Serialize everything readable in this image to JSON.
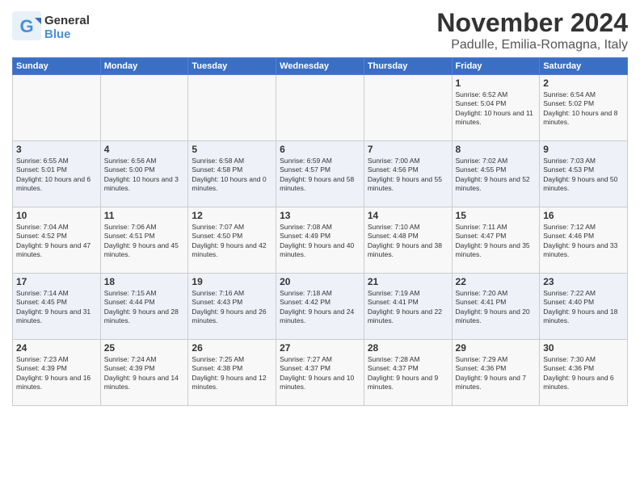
{
  "logo": {
    "line1": "General",
    "line2": "Blue"
  },
  "title": "November 2024",
  "location": "Padulle, Emilia-Romagna, Italy",
  "days_of_week": [
    "Sunday",
    "Monday",
    "Tuesday",
    "Wednesday",
    "Thursday",
    "Friday",
    "Saturday"
  ],
  "weeks": [
    [
      {
        "day": "",
        "info": ""
      },
      {
        "day": "",
        "info": ""
      },
      {
        "day": "",
        "info": ""
      },
      {
        "day": "",
        "info": ""
      },
      {
        "day": "",
        "info": ""
      },
      {
        "day": "1",
        "info": "Sunrise: 6:52 AM\nSunset: 5:04 PM\nDaylight: 10 hours and 11 minutes."
      },
      {
        "day": "2",
        "info": "Sunrise: 6:54 AM\nSunset: 5:02 PM\nDaylight: 10 hours and 8 minutes."
      }
    ],
    [
      {
        "day": "3",
        "info": "Sunrise: 6:55 AM\nSunset: 5:01 PM\nDaylight: 10 hours and 6 minutes."
      },
      {
        "day": "4",
        "info": "Sunrise: 6:56 AM\nSunset: 5:00 PM\nDaylight: 10 hours and 3 minutes."
      },
      {
        "day": "5",
        "info": "Sunrise: 6:58 AM\nSunset: 4:58 PM\nDaylight: 10 hours and 0 minutes."
      },
      {
        "day": "6",
        "info": "Sunrise: 6:59 AM\nSunset: 4:57 PM\nDaylight: 9 hours and 58 minutes."
      },
      {
        "day": "7",
        "info": "Sunrise: 7:00 AM\nSunset: 4:56 PM\nDaylight: 9 hours and 55 minutes."
      },
      {
        "day": "8",
        "info": "Sunrise: 7:02 AM\nSunset: 4:55 PM\nDaylight: 9 hours and 52 minutes."
      },
      {
        "day": "9",
        "info": "Sunrise: 7:03 AM\nSunset: 4:53 PM\nDaylight: 9 hours and 50 minutes."
      }
    ],
    [
      {
        "day": "10",
        "info": "Sunrise: 7:04 AM\nSunset: 4:52 PM\nDaylight: 9 hours and 47 minutes."
      },
      {
        "day": "11",
        "info": "Sunrise: 7:06 AM\nSunset: 4:51 PM\nDaylight: 9 hours and 45 minutes."
      },
      {
        "day": "12",
        "info": "Sunrise: 7:07 AM\nSunset: 4:50 PM\nDaylight: 9 hours and 42 minutes."
      },
      {
        "day": "13",
        "info": "Sunrise: 7:08 AM\nSunset: 4:49 PM\nDaylight: 9 hours and 40 minutes."
      },
      {
        "day": "14",
        "info": "Sunrise: 7:10 AM\nSunset: 4:48 PM\nDaylight: 9 hours and 38 minutes."
      },
      {
        "day": "15",
        "info": "Sunrise: 7:11 AM\nSunset: 4:47 PM\nDaylight: 9 hours and 35 minutes."
      },
      {
        "day": "16",
        "info": "Sunrise: 7:12 AM\nSunset: 4:46 PM\nDaylight: 9 hours and 33 minutes."
      }
    ],
    [
      {
        "day": "17",
        "info": "Sunrise: 7:14 AM\nSunset: 4:45 PM\nDaylight: 9 hours and 31 minutes."
      },
      {
        "day": "18",
        "info": "Sunrise: 7:15 AM\nSunset: 4:44 PM\nDaylight: 9 hours and 28 minutes."
      },
      {
        "day": "19",
        "info": "Sunrise: 7:16 AM\nSunset: 4:43 PM\nDaylight: 9 hours and 26 minutes."
      },
      {
        "day": "20",
        "info": "Sunrise: 7:18 AM\nSunset: 4:42 PM\nDaylight: 9 hours and 24 minutes."
      },
      {
        "day": "21",
        "info": "Sunrise: 7:19 AM\nSunset: 4:41 PM\nDaylight: 9 hours and 22 minutes."
      },
      {
        "day": "22",
        "info": "Sunrise: 7:20 AM\nSunset: 4:41 PM\nDaylight: 9 hours and 20 minutes."
      },
      {
        "day": "23",
        "info": "Sunrise: 7:22 AM\nSunset: 4:40 PM\nDaylight: 9 hours and 18 minutes."
      }
    ],
    [
      {
        "day": "24",
        "info": "Sunrise: 7:23 AM\nSunset: 4:39 PM\nDaylight: 9 hours and 16 minutes."
      },
      {
        "day": "25",
        "info": "Sunrise: 7:24 AM\nSunset: 4:39 PM\nDaylight: 9 hours and 14 minutes."
      },
      {
        "day": "26",
        "info": "Sunrise: 7:25 AM\nSunset: 4:38 PM\nDaylight: 9 hours and 12 minutes."
      },
      {
        "day": "27",
        "info": "Sunrise: 7:27 AM\nSunset: 4:37 PM\nDaylight: 9 hours and 10 minutes."
      },
      {
        "day": "28",
        "info": "Sunrise: 7:28 AM\nSunset: 4:37 PM\nDaylight: 9 hours and 9 minutes."
      },
      {
        "day": "29",
        "info": "Sunrise: 7:29 AM\nSunset: 4:36 PM\nDaylight: 9 hours and 7 minutes."
      },
      {
        "day": "30",
        "info": "Sunrise: 7:30 AM\nSunset: 4:36 PM\nDaylight: 9 hours and 6 minutes."
      }
    ]
  ]
}
